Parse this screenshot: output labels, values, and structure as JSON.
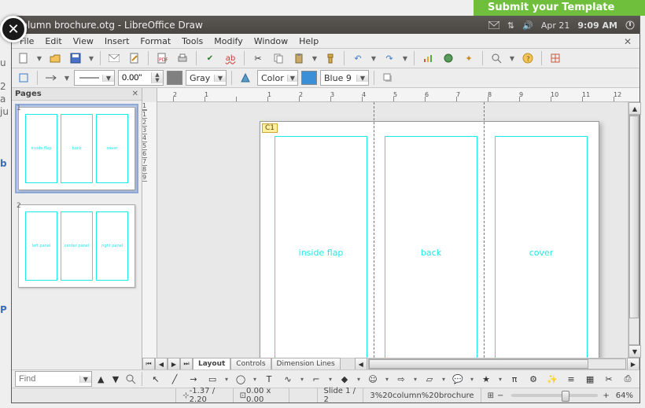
{
  "os": {
    "banner_text": "Submit your Template",
    "date": "Apr 21",
    "time": "9:09 AM",
    "behind_lines": [
      "u",
      "2",
      "a",
      "ju",
      "b",
      "P"
    ]
  },
  "window": {
    "title": "column brochure.otg - LibreOffice Draw"
  },
  "menu": {
    "items": [
      "File",
      "Edit",
      "View",
      "Insert",
      "Format",
      "Tools",
      "Modify",
      "Window",
      "Help"
    ]
  },
  "toolbar2": {
    "line_width": "0.00\"",
    "line_color_label": "Gray",
    "fill_label": "Color",
    "fill_color_label": "Blue 9",
    "fill_color_hex": "#3a8fd6"
  },
  "pages_panel": {
    "title": "Pages",
    "slides": [
      {
        "num": "1",
        "selected": true,
        "cols": [
          "inside flap",
          "back",
          "cover"
        ]
      },
      {
        "num": "2",
        "selected": false,
        "cols": [
          "left panel",
          "center panel",
          "right panel"
        ]
      }
    ]
  },
  "ruler": {
    "hticks": [
      "2",
      "1",
      "",
      "1",
      "2",
      "3",
      "4",
      "5",
      "6",
      "7",
      "8",
      "9",
      "10",
      "11",
      "12"
    ],
    "vticks": [
      "1",
      "",
      "1",
      "2",
      "3",
      "4",
      "5",
      "6",
      "7",
      "8",
      "9"
    ]
  },
  "canvas": {
    "cell_ref": "C1",
    "panels": [
      "inside flap",
      "back",
      "cover"
    ]
  },
  "tabs": {
    "items": [
      "Layout",
      "Controls",
      "Dimension Lines"
    ],
    "active": 0
  },
  "find": {
    "placeholder": "Find"
  },
  "status": {
    "coords": "-1.37 / 2.20",
    "size": "0.00 x 0.00",
    "slide": "Slide 1 / 2",
    "layout": "3%20column%20brochure",
    "zoom": "64%"
  },
  "toolbar3_icons": [
    "pointer",
    "line",
    "arrow",
    "rect",
    "ellipse",
    "text",
    "curve",
    "connector",
    "shapes",
    "symbol",
    "block-arrow",
    "flowchart",
    "callout",
    "star",
    "pi",
    "interaction",
    "effects",
    "align",
    "arrange",
    "crop",
    "pdf"
  ]
}
